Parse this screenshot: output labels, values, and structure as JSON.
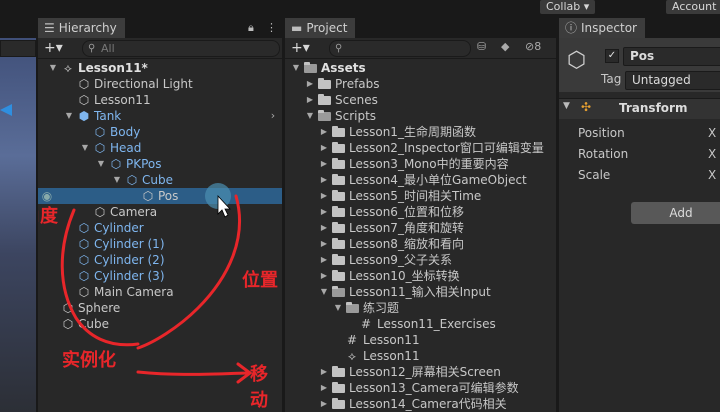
{
  "topbar": {
    "collab_label": "Collab ▾",
    "account_label": "Account"
  },
  "hierarchy": {
    "tab_title": "Hierarchy",
    "search_placeholder": "All",
    "items": [
      {
        "label": "Lesson11*",
        "depth": 0,
        "expand": "▼",
        "icon": "unity-scene-icon",
        "style": "root"
      },
      {
        "label": "Directional Light",
        "depth": 1,
        "expand": "",
        "icon": "cube-icon"
      },
      {
        "label": "Lesson11",
        "depth": 1,
        "expand": "",
        "icon": "cube-icon"
      },
      {
        "label": "Tank",
        "depth": 1,
        "expand": "▼",
        "icon": "prefab-cube-icon",
        "style": "blue"
      },
      {
        "label": "Body",
        "depth": 2,
        "expand": "",
        "icon": "cube-icon",
        "style": "blue"
      },
      {
        "label": "Head",
        "depth": 2,
        "expand": "▼",
        "icon": "cube-icon",
        "style": "blue"
      },
      {
        "label": "PKPos",
        "depth": 3,
        "expand": "▼",
        "icon": "cube-icon",
        "style": "blue"
      },
      {
        "label": "Cube",
        "depth": 4,
        "expand": "▼",
        "icon": "cube-icon",
        "style": "blue"
      },
      {
        "label": "Pos",
        "depth": 5,
        "expand": "",
        "icon": "cube-script-icon",
        "style": "selected"
      },
      {
        "label": "Camera",
        "depth": 2,
        "expand": "",
        "icon": "cube-script-icon"
      },
      {
        "label": "Cylinder",
        "depth": 1,
        "expand": "",
        "icon": "cube-icon",
        "style": "blue"
      },
      {
        "label": "Cylinder (1)",
        "depth": 1,
        "expand": "",
        "icon": "cube-icon",
        "style": "blue"
      },
      {
        "label": "Cylinder (2)",
        "depth": 1,
        "expand": "",
        "icon": "cube-icon",
        "style": "blue"
      },
      {
        "label": "Cylinder (3)",
        "depth": 1,
        "expand": "",
        "icon": "cube-icon",
        "style": "blue"
      },
      {
        "label": "Main Camera",
        "depth": 1,
        "expand": "",
        "icon": "cube-script-icon"
      },
      {
        "label": "Sphere",
        "depth": 0,
        "expand": "",
        "icon": "cube-icon"
      },
      {
        "label": "Cube",
        "depth": 0,
        "expand": "",
        "icon": "cube-icon"
      }
    ]
  },
  "annotations": {
    "angle": "角度",
    "position": "位置",
    "instantiate": "实例化",
    "move": "移动"
  },
  "project": {
    "tab_title": "Project",
    "badge": "8",
    "items": [
      {
        "label": "Assets",
        "depth": 0,
        "expand": "▼",
        "icon": "folder-open",
        "style": "root"
      },
      {
        "label": "Prefabs",
        "depth": 1,
        "expand": "▶",
        "icon": "folder"
      },
      {
        "label": "Scenes",
        "depth": 1,
        "expand": "▶",
        "icon": "folder"
      },
      {
        "label": "Scripts",
        "depth": 1,
        "expand": "▼",
        "icon": "folder-open"
      },
      {
        "label": "Lesson1_生命周期函数",
        "depth": 2,
        "expand": "▶",
        "icon": "folder"
      },
      {
        "label": "Lesson2_Inspector窗口可编辑变量",
        "depth": 2,
        "expand": "▶",
        "icon": "folder"
      },
      {
        "label": "Lesson3_Mono中的重要内容",
        "depth": 2,
        "expand": "▶",
        "icon": "folder"
      },
      {
        "label": "Lesson4_最小单位GameObject",
        "depth": 2,
        "expand": "▶",
        "icon": "folder"
      },
      {
        "label": "Lesson5_时间相关Time",
        "depth": 2,
        "expand": "▶",
        "icon": "folder"
      },
      {
        "label": "Lesson6_位置和位移",
        "depth": 2,
        "expand": "▶",
        "icon": "folder"
      },
      {
        "label": "Lesson7_角度和旋转",
        "depth": 2,
        "expand": "▶",
        "icon": "folder"
      },
      {
        "label": "Lesson8_缩放和看向",
        "depth": 2,
        "expand": "▶",
        "icon": "folder"
      },
      {
        "label": "Lesson9_父子关系",
        "depth": 2,
        "expand": "▶",
        "icon": "folder"
      },
      {
        "label": "Lesson10_坐标转换",
        "depth": 2,
        "expand": "▶",
        "icon": "folder"
      },
      {
        "label": "Lesson11_输入相关Input",
        "depth": 2,
        "expand": "▼",
        "icon": "folder-open"
      },
      {
        "label": "练习题",
        "depth": 3,
        "expand": "▼",
        "icon": "folder-open"
      },
      {
        "label": "Lesson11_Exercises",
        "depth": 4,
        "expand": "",
        "icon": "script"
      },
      {
        "label": "Lesson11",
        "depth": 3,
        "expand": "",
        "icon": "script"
      },
      {
        "label": "Lesson11",
        "depth": 3,
        "expand": "",
        "icon": "scene"
      },
      {
        "label": "Lesson12_屏幕相关Screen",
        "depth": 2,
        "expand": "▶",
        "icon": "folder"
      },
      {
        "label": "Lesson13_Camera可编辑参数",
        "depth": 2,
        "expand": "▶",
        "icon": "folder"
      },
      {
        "label": "Lesson14_Camera代码相关",
        "depth": 2,
        "expand": "▶",
        "icon": "folder"
      }
    ]
  },
  "inspector": {
    "tab_title": "Inspector",
    "object_name": "Pos",
    "tag_label": "Tag",
    "tag_value": "Untagged",
    "component_title": "Transform",
    "rows": [
      {
        "label": "Position",
        "axis": "X"
      },
      {
        "label": "Rotation",
        "axis": "X"
      },
      {
        "label": "Scale",
        "axis": "X"
      }
    ],
    "add_label": "Add"
  }
}
